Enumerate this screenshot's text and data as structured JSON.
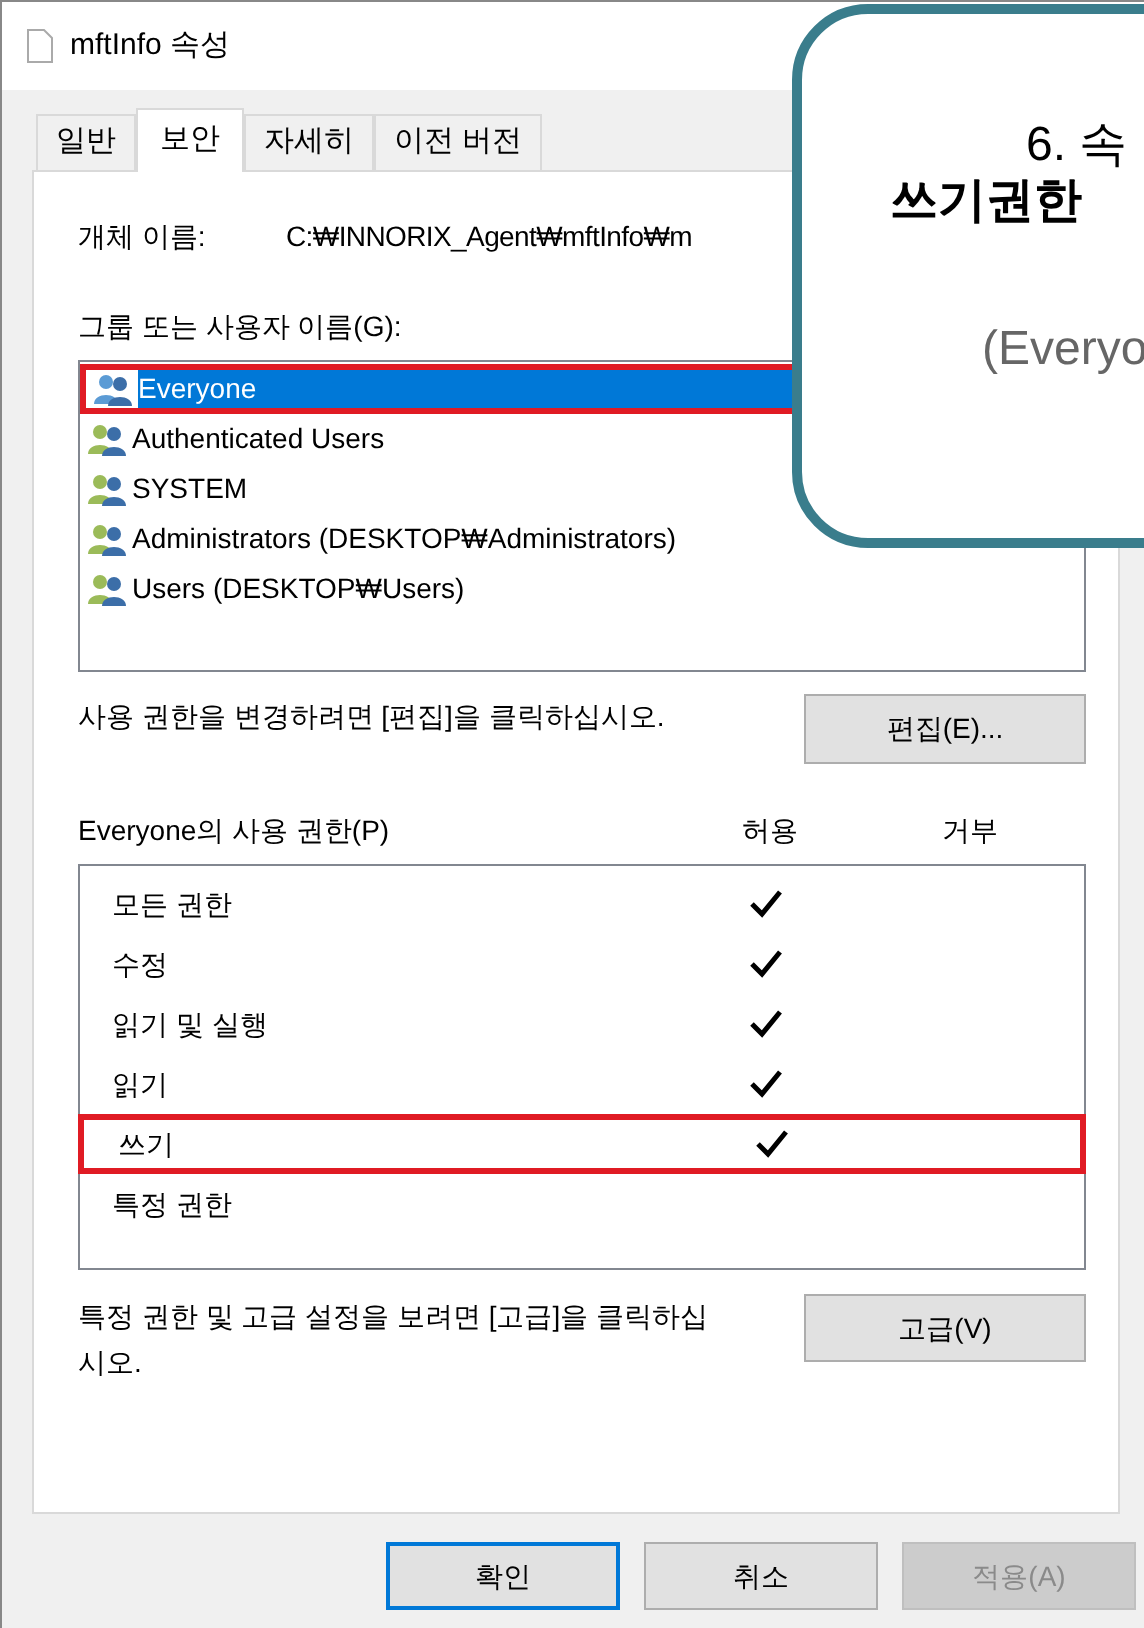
{
  "window": {
    "title": "mftInfo 속성"
  },
  "tabs": [
    {
      "label": "일반",
      "selected": false
    },
    {
      "label": "보안",
      "selected": true
    },
    {
      "label": "자세히",
      "selected": false
    },
    {
      "label": "이전 버전",
      "selected": false
    }
  ],
  "object_name": {
    "label": "개체 이름:",
    "value": "C:₩INNORIX_Agent₩mftInfo₩m"
  },
  "groups": {
    "label": "그룹 또는 사용자 이름(G):",
    "items": [
      {
        "name": "Everyone",
        "selected": true,
        "highlighted": true
      },
      {
        "name": "Authenticated Users",
        "selected": false,
        "highlighted": false
      },
      {
        "name": "SYSTEM",
        "selected": false,
        "highlighted": false
      },
      {
        "name": "Administrators (DESKTOP₩Administrators)",
        "selected": false,
        "highlighted": false
      },
      {
        "name": "Users (DESKTOP₩Users)",
        "selected": false,
        "highlighted": false
      }
    ]
  },
  "edit": {
    "hint": "사용 권한을 변경하려면 [편집]을 클릭하십시오.",
    "button": "편집(E)..."
  },
  "permissions": {
    "label": "Everyone의 사용 권한(P)",
    "allow_header": "허용",
    "deny_header": "거부",
    "rows": [
      {
        "name": "모든 권한",
        "allow": true,
        "deny": false,
        "highlighted": false
      },
      {
        "name": "수정",
        "allow": true,
        "deny": false,
        "highlighted": false
      },
      {
        "name": "읽기 및 실행",
        "allow": true,
        "deny": false,
        "highlighted": false
      },
      {
        "name": "읽기",
        "allow": true,
        "deny": false,
        "highlighted": false
      },
      {
        "name": "쓰기",
        "allow": true,
        "deny": false,
        "highlighted": true
      },
      {
        "name": "특정 권한",
        "allow": false,
        "deny": false,
        "highlighted": false
      }
    ]
  },
  "advanced": {
    "hint": "특정 권한 및 고급 설정을 보려면 [고급]을 클릭하십시오.",
    "button": "고급(V)"
  },
  "buttons": [
    {
      "label": "확인",
      "kind": "default",
      "disabled": false
    },
    {
      "label": "취소",
      "kind": "normal",
      "disabled": false
    },
    {
      "label": "적용(A)",
      "kind": "normal",
      "disabled": true
    }
  ],
  "callout": {
    "lines": [
      {
        "text": "6. 속",
        "kind": "normal"
      },
      {
        "text": "쓰기권한",
        "kind": "bold"
      },
      {
        "text": "(Everyo",
        "kind": "muted"
      }
    ]
  }
}
